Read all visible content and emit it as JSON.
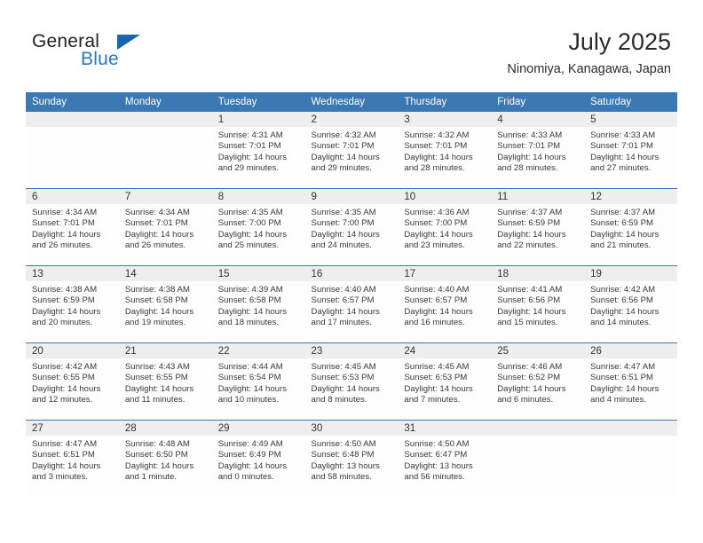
{
  "brand": {
    "name_part1": "General",
    "name_part2": "Blue",
    "logo_icon": "triangle-flag-icon",
    "accent_color": "#1f7cc2"
  },
  "header": {
    "month_title": "July 2025",
    "location": "Ninomiya, Kanagawa, Japan"
  },
  "theme": {
    "header_blue": "#3b78b4",
    "date_band_gray": "#eeeeee",
    "text_color": "#3a3a3a"
  },
  "calendar": {
    "weekday_headers": [
      "Sunday",
      "Monday",
      "Tuesday",
      "Wednesday",
      "Thursday",
      "Friday",
      "Saturday"
    ],
    "weeks": [
      [
        {
          "day": "",
          "empty": true,
          "sunrise": "",
          "sunset": "",
          "daylight_line1": "",
          "daylight_line2": ""
        },
        {
          "day": "",
          "empty": true,
          "sunrise": "",
          "sunset": "",
          "daylight_line1": "",
          "daylight_line2": ""
        },
        {
          "day": "1",
          "sunrise": "Sunrise: 4:31 AM",
          "sunset": "Sunset: 7:01 PM",
          "daylight_line1": "Daylight: 14 hours",
          "daylight_line2": "and 29 minutes."
        },
        {
          "day": "2",
          "sunrise": "Sunrise: 4:32 AM",
          "sunset": "Sunset: 7:01 PM",
          "daylight_line1": "Daylight: 14 hours",
          "daylight_line2": "and 29 minutes."
        },
        {
          "day": "3",
          "sunrise": "Sunrise: 4:32 AM",
          "sunset": "Sunset: 7:01 PM",
          "daylight_line1": "Daylight: 14 hours",
          "daylight_line2": "and 28 minutes."
        },
        {
          "day": "4",
          "sunrise": "Sunrise: 4:33 AM",
          "sunset": "Sunset: 7:01 PM",
          "daylight_line1": "Daylight: 14 hours",
          "daylight_line2": "and 28 minutes."
        },
        {
          "day": "5",
          "sunrise": "Sunrise: 4:33 AM",
          "sunset": "Sunset: 7:01 PM",
          "daylight_line1": "Daylight: 14 hours",
          "daylight_line2": "and 27 minutes."
        }
      ],
      [
        {
          "day": "6",
          "sunrise": "Sunrise: 4:34 AM",
          "sunset": "Sunset: 7:01 PM",
          "daylight_line1": "Daylight: 14 hours",
          "daylight_line2": "and 26 minutes."
        },
        {
          "day": "7",
          "sunrise": "Sunrise: 4:34 AM",
          "sunset": "Sunset: 7:01 PM",
          "daylight_line1": "Daylight: 14 hours",
          "daylight_line2": "and 26 minutes."
        },
        {
          "day": "8",
          "sunrise": "Sunrise: 4:35 AM",
          "sunset": "Sunset: 7:00 PM",
          "daylight_line1": "Daylight: 14 hours",
          "daylight_line2": "and 25 minutes."
        },
        {
          "day": "9",
          "sunrise": "Sunrise: 4:35 AM",
          "sunset": "Sunset: 7:00 PM",
          "daylight_line1": "Daylight: 14 hours",
          "daylight_line2": "and 24 minutes."
        },
        {
          "day": "10",
          "sunrise": "Sunrise: 4:36 AM",
          "sunset": "Sunset: 7:00 PM",
          "daylight_line1": "Daylight: 14 hours",
          "daylight_line2": "and 23 minutes."
        },
        {
          "day": "11",
          "sunrise": "Sunrise: 4:37 AM",
          "sunset": "Sunset: 6:59 PM",
          "daylight_line1": "Daylight: 14 hours",
          "daylight_line2": "and 22 minutes."
        },
        {
          "day": "12",
          "sunrise": "Sunrise: 4:37 AM",
          "sunset": "Sunset: 6:59 PM",
          "daylight_line1": "Daylight: 14 hours",
          "daylight_line2": "and 21 minutes."
        }
      ],
      [
        {
          "day": "13",
          "sunrise": "Sunrise: 4:38 AM",
          "sunset": "Sunset: 6:59 PM",
          "daylight_line1": "Daylight: 14 hours",
          "daylight_line2": "and 20 minutes."
        },
        {
          "day": "14",
          "sunrise": "Sunrise: 4:38 AM",
          "sunset": "Sunset: 6:58 PM",
          "daylight_line1": "Daylight: 14 hours",
          "daylight_line2": "and 19 minutes."
        },
        {
          "day": "15",
          "sunrise": "Sunrise: 4:39 AM",
          "sunset": "Sunset: 6:58 PM",
          "daylight_line1": "Daylight: 14 hours",
          "daylight_line2": "and 18 minutes."
        },
        {
          "day": "16",
          "sunrise": "Sunrise: 4:40 AM",
          "sunset": "Sunset: 6:57 PM",
          "daylight_line1": "Daylight: 14 hours",
          "daylight_line2": "and 17 minutes."
        },
        {
          "day": "17",
          "sunrise": "Sunrise: 4:40 AM",
          "sunset": "Sunset: 6:57 PM",
          "daylight_line1": "Daylight: 14 hours",
          "daylight_line2": "and 16 minutes."
        },
        {
          "day": "18",
          "sunrise": "Sunrise: 4:41 AM",
          "sunset": "Sunset: 6:56 PM",
          "daylight_line1": "Daylight: 14 hours",
          "daylight_line2": "and 15 minutes."
        },
        {
          "day": "19",
          "sunrise": "Sunrise: 4:42 AM",
          "sunset": "Sunset: 6:56 PM",
          "daylight_line1": "Daylight: 14 hours",
          "daylight_line2": "and 14 minutes."
        }
      ],
      [
        {
          "day": "20",
          "sunrise": "Sunrise: 4:42 AM",
          "sunset": "Sunset: 6:55 PM",
          "daylight_line1": "Daylight: 14 hours",
          "daylight_line2": "and 12 minutes."
        },
        {
          "day": "21",
          "sunrise": "Sunrise: 4:43 AM",
          "sunset": "Sunset: 6:55 PM",
          "daylight_line1": "Daylight: 14 hours",
          "daylight_line2": "and 11 minutes."
        },
        {
          "day": "22",
          "sunrise": "Sunrise: 4:44 AM",
          "sunset": "Sunset: 6:54 PM",
          "daylight_line1": "Daylight: 14 hours",
          "daylight_line2": "and 10 minutes."
        },
        {
          "day": "23",
          "sunrise": "Sunrise: 4:45 AM",
          "sunset": "Sunset: 6:53 PM",
          "daylight_line1": "Daylight: 14 hours",
          "daylight_line2": "and 8 minutes."
        },
        {
          "day": "24",
          "sunrise": "Sunrise: 4:45 AM",
          "sunset": "Sunset: 6:53 PM",
          "daylight_line1": "Daylight: 14 hours",
          "daylight_line2": "and 7 minutes."
        },
        {
          "day": "25",
          "sunrise": "Sunrise: 4:46 AM",
          "sunset": "Sunset: 6:52 PM",
          "daylight_line1": "Daylight: 14 hours",
          "daylight_line2": "and 6 minutes."
        },
        {
          "day": "26",
          "sunrise": "Sunrise: 4:47 AM",
          "sunset": "Sunset: 6:51 PM",
          "daylight_line1": "Daylight: 14 hours",
          "daylight_line2": "and 4 minutes."
        }
      ],
      [
        {
          "day": "27",
          "sunrise": "Sunrise: 4:47 AM",
          "sunset": "Sunset: 6:51 PM",
          "daylight_line1": "Daylight: 14 hours",
          "daylight_line2": "and 3 minutes."
        },
        {
          "day": "28",
          "sunrise": "Sunrise: 4:48 AM",
          "sunset": "Sunset: 6:50 PM",
          "daylight_line1": "Daylight: 14 hours",
          "daylight_line2": "and 1 minute."
        },
        {
          "day": "29",
          "sunrise": "Sunrise: 4:49 AM",
          "sunset": "Sunset: 6:49 PM",
          "daylight_line1": "Daylight: 14 hours",
          "daylight_line2": "and 0 minutes."
        },
        {
          "day": "30",
          "sunrise": "Sunrise: 4:50 AM",
          "sunset": "Sunset: 6:48 PM",
          "daylight_line1": "Daylight: 13 hours",
          "daylight_line2": "and 58 minutes."
        },
        {
          "day": "31",
          "sunrise": "Sunrise: 4:50 AM",
          "sunset": "Sunset: 6:47 PM",
          "daylight_line1": "Daylight: 13 hours",
          "daylight_line2": "and 56 minutes."
        },
        {
          "day": "",
          "empty": true,
          "sunrise": "",
          "sunset": "",
          "daylight_line1": "",
          "daylight_line2": ""
        },
        {
          "day": "",
          "empty": true,
          "sunrise": "",
          "sunset": "",
          "daylight_line1": "",
          "daylight_line2": ""
        }
      ]
    ]
  }
}
